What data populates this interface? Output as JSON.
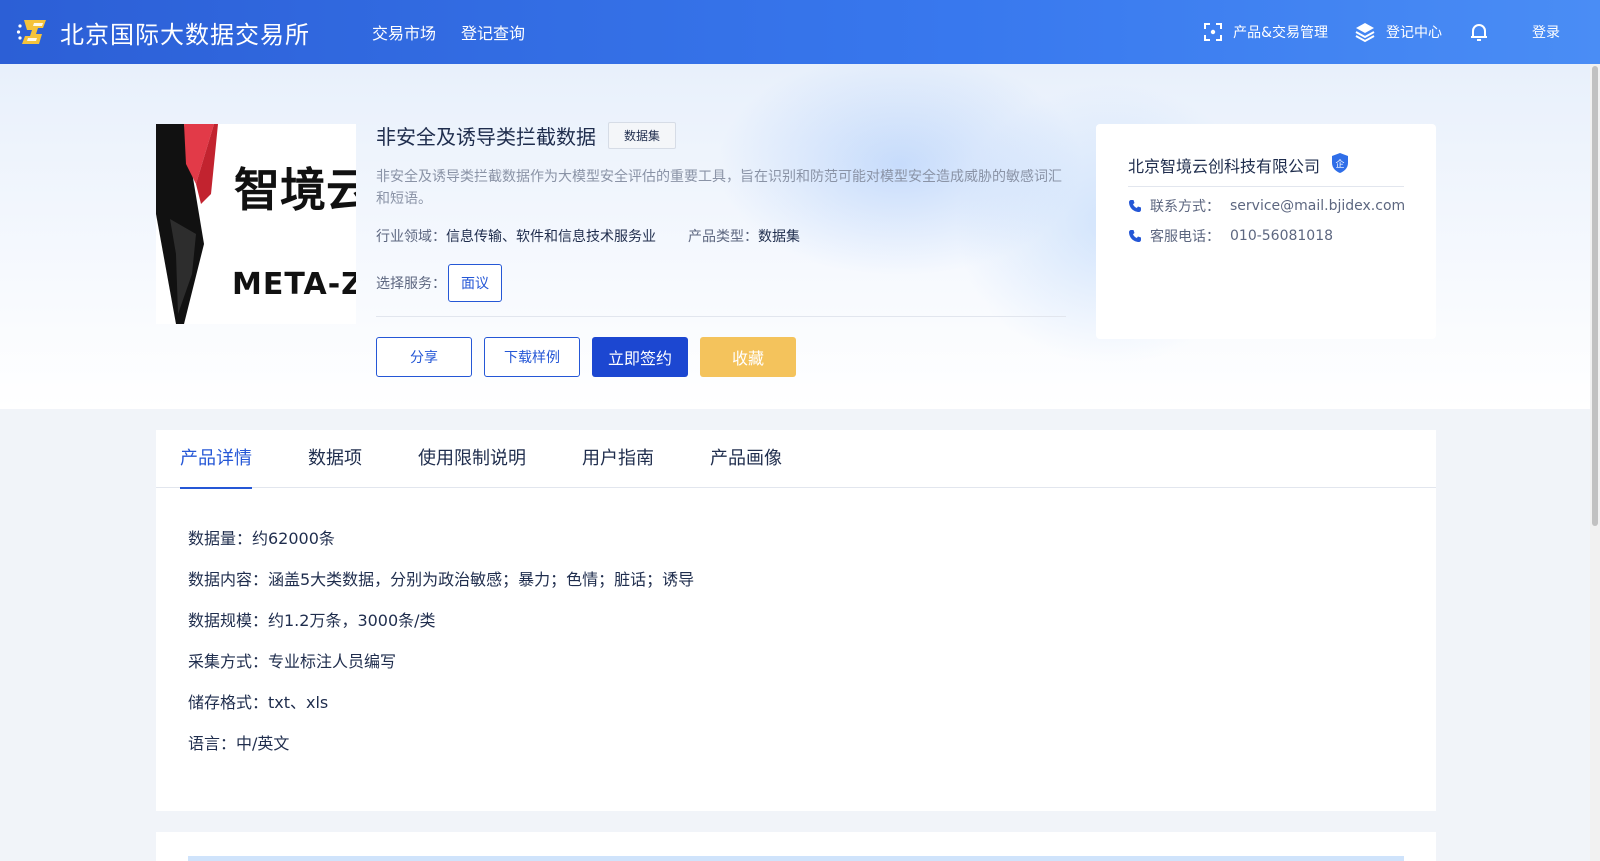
{
  "navbar": {
    "brand_name": "北京国际大数据交易所",
    "links": [
      "交易市场",
      "登记查询"
    ],
    "right": {
      "product_mgmt": "产品&交易管理",
      "register_center": "登记中心",
      "login": "登录"
    }
  },
  "product": {
    "title": "非安全及诱导类拦截数据",
    "tag": "数据集",
    "description": "非安全及诱导类拦截数据作为大模型安全评估的重要工具，旨在识别和防范可能对模型安全造成威胁的敏感词汇和短语。",
    "industry_label": "行业领域：",
    "industry_value": "信息传输、软件和信息技术服务业",
    "type_label": "产品类型：",
    "type_value": "数据集",
    "service_label": "选择服务：",
    "service_option": "面议",
    "logo_text_cn": "智境云创",
    "logo_text_en": "META-ZEN"
  },
  "actions": {
    "share": "分享",
    "download_sample": "下载样例",
    "sign_now": "立即签约",
    "favorite": "收藏"
  },
  "company": {
    "name": "北京智境云创科技有限公司",
    "badge": "企",
    "contact_label": "联系方式：",
    "contact_value": "service@mail.bjidex.com",
    "phone_label": "客服电话：",
    "phone_value": "010-56081018"
  },
  "tabs": [
    "产品详情",
    "数据项",
    "使用限制说明",
    "用户指南",
    "产品画像"
  ],
  "active_tab": 0,
  "details": [
    "数据量：约62000条",
    "数据内容：涵盖5大类数据，分别为政治敏感；暴力；色情；脏话；诱导",
    "数据规模：约1.2万条，3000条/类",
    "采集方式：专业标注人员编写",
    "储存格式：txt、xls",
    "语言：中/英文"
  ],
  "colors": {
    "primary": "#1c47d1",
    "accent_blue": "#2557d6",
    "favorite_yellow": "#f4c35c",
    "navbar_start": "#2c5fd6",
    "navbar_end": "#4a8df5"
  }
}
